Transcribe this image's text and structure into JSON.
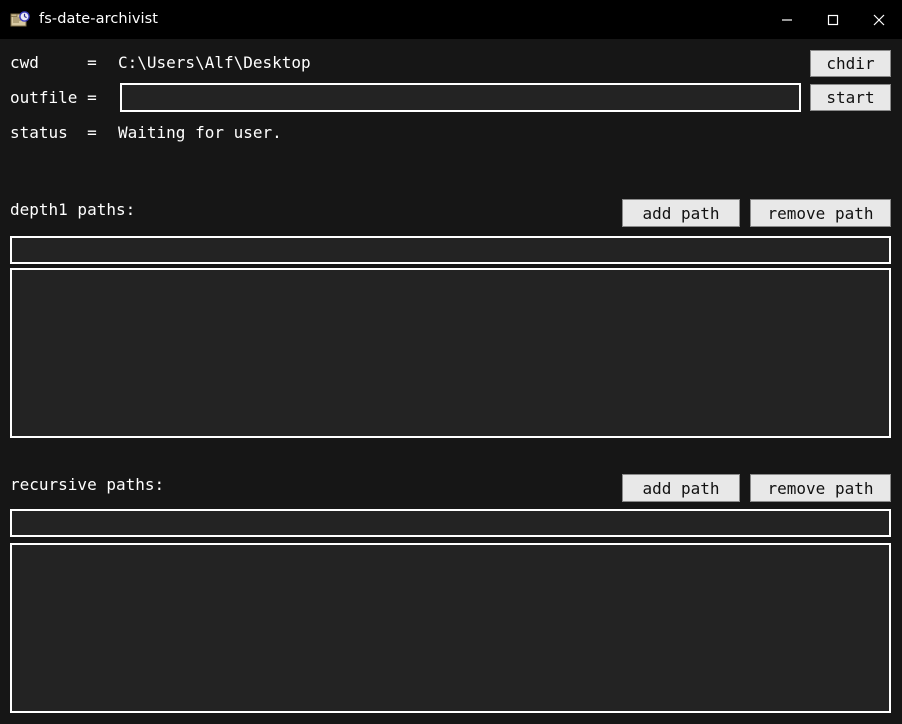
{
  "window": {
    "title": "fs-date-archivist",
    "icon": "folder-clock-icon",
    "minimize_label": "—",
    "maximize_label": "□",
    "close_label": "✕",
    "bg": "#161616",
    "titlebar_bg": "#000000"
  },
  "fields": {
    "cwd_label": "cwd     = ",
    "cwd_value": "C:\\Users\\Alf\\Desktop",
    "outfile_label": "outfile = ",
    "outfile_value": "",
    "outfile_placeholder": "",
    "status_label": "status  = ",
    "status_value": "Waiting for user."
  },
  "toolbar": {
    "chdir_label": "chdir",
    "start_label": "start"
  },
  "sections": [
    {
      "heading": "depth1 paths:",
      "add_label": "add path",
      "remove_label": "remove path",
      "entry_value": "",
      "items": []
    },
    {
      "heading": "recursive paths:",
      "add_label": "add path",
      "remove_label": "remove path",
      "entry_value": "",
      "items": []
    }
  ],
  "colors": {
    "panel_bg": "#232323",
    "border": "#ffffff",
    "button_bg": "#e8e8e8",
    "text": "#ffffff"
  }
}
